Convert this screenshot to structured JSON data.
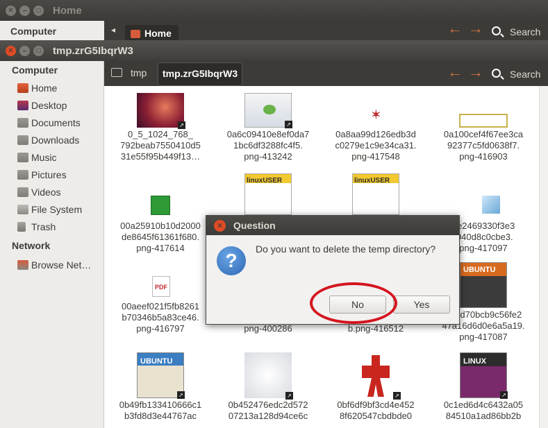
{
  "back_window": {
    "title": "Home",
    "sidebar_heading": "Computer",
    "tab": "Home",
    "search_label": "Search"
  },
  "window": {
    "title": "tmp.zrG5IbqrW3",
    "search_label": "Search",
    "breadcrumbs": [
      "tmp",
      "tmp.zrG5IbqrW3"
    ]
  },
  "sidebar": {
    "computer_heading": "Computer",
    "items": [
      {
        "label": "Home",
        "icon": "home-folder-icon"
      },
      {
        "label": "Desktop",
        "icon": "desktop-folder-icon"
      },
      {
        "label": "Documents",
        "icon": "documents-folder-icon"
      },
      {
        "label": "Downloads",
        "icon": "downloads-folder-icon"
      },
      {
        "label": "Music",
        "icon": "music-folder-icon"
      },
      {
        "label": "Pictures",
        "icon": "pictures-folder-icon"
      },
      {
        "label": "Videos",
        "icon": "videos-folder-icon"
      },
      {
        "label": "File System",
        "icon": "drive-icon"
      },
      {
        "label": "Trash",
        "icon": "trash-icon"
      }
    ],
    "network_heading": "Network",
    "network_items": [
      {
        "label": "Browse Net…",
        "icon": "network-icon"
      }
    ]
  },
  "files": [
    {
      "name": "0_5_1024_768_\n792beab7550410d5\n31e55f95b449f13…"
    },
    {
      "name": "0a6c09410e8ef0da7\n1bc6df3288fc4f5.\npng-413242"
    },
    {
      "name": "0a8aa99d126edb3d\nc0279e1c9e34ca31.\npng-417548"
    },
    {
      "name": "0a100cef4f67ee3ca\n92377c5fd0638f7.\npng-416903"
    },
    {
      "name": "00a25910b10d2000\nde8645f61361f680.\npng-417614"
    },
    {
      "name": ""
    },
    {
      "name": ""
    },
    {
      "name": "9e2469330f3e3\nf940d8c0cbe3.\npng-417097"
    },
    {
      "name": "00aeef021f5fb8261\nb70346b5a83ce46.\npng-416797"
    },
    {
      "name": "0b0d5c05ee79239b\n61aac7e8b999a011.\npng-400286"
    },
    {
      "name": "0b8eb78d0c6898a\ned91eda10d156d6\nb.png-416512"
    },
    {
      "name": "0b8d70bcb9c56fe2\n47a16d6d0e6a5a19.\npng-417087"
    },
    {
      "name": "0b49fb133410666c1\nb3fd8d3e44767ac"
    },
    {
      "name": "0b452476edc2d572\n07213a128d94ce6c"
    },
    {
      "name": "0bf6df9bf3cd4e452\n8f620547cbdbde0"
    },
    {
      "name": "0c1ed6d4c6432a05\n84510a1ad86bb2b"
    }
  ],
  "dialog": {
    "title": "Question",
    "message": "Do you want to delete the temp directory?",
    "no_label": "No",
    "yes_label": "Yes"
  },
  "colors": {
    "accent": "#df4b25",
    "titlebar": "#3c3b37",
    "sidebar_bg": "#edece9",
    "highlight_ring": "#d4151f"
  }
}
